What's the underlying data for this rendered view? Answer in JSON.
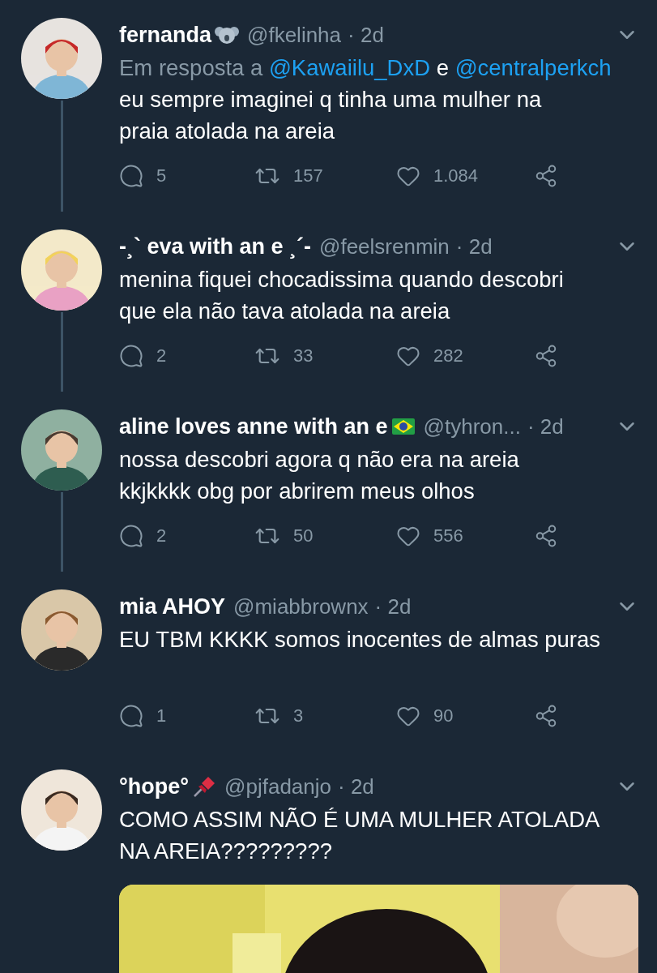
{
  "tweets": [
    {
      "name": "fernanda",
      "badge": {
        "kind": "koala"
      },
      "handle": "@fkelinha",
      "time": "· 2d",
      "reply_to": {
        "prefix": "Em resposta a",
        "users": [
          "@Kawaiilu_DxD",
          "@centralperkch"
        ],
        "joiner": "e"
      },
      "text_lines": [
        "eu sempre imaginei q tinha uma mulher na",
        "praia atolada na areia"
      ],
      "replies": "5",
      "retweets": "157",
      "likes": "1.084",
      "thread_continues": true
    },
    {
      "name": "-¸` eva with an e ¸´-",
      "handle": "@feelsrenmin",
      "time": "· 2d",
      "text_lines": [
        "menina fiquei chocadissima quando descobri",
        "que ela não tava atolada na areia"
      ],
      "replies": "2",
      "retweets": "33",
      "likes": "282",
      "thread_continues": true
    },
    {
      "name": "aline loves anne with an e",
      "badge": {
        "kind": "flag"
      },
      "handle": "@tyhron...",
      "time": "· 2d",
      "text_lines": [
        "nossa descobri agora q não era na areia",
        "kkjkkkk obg por abrirem meus olhos"
      ],
      "replies": "2",
      "retweets": "50",
      "likes": "556",
      "thread_continues": true
    },
    {
      "name": "mia AHOY",
      "handle": "@miabbrownx",
      "time": "· 2d",
      "text_lines": [
        "EU TBM KKKK somos inocentes de almas puras"
      ],
      "replies": "1",
      "retweets": "3",
      "likes": "90",
      "thread_continues": false
    },
    {
      "name": "°hope°",
      "badge": {
        "kind": "pin"
      },
      "handle": "@pjfadanjo",
      "time": "· 2d",
      "text_lines": [
        "COMO ASSIM NÃO É UMA MULHER ATOLADA",
        "NA AREIA?????????"
      ],
      "thread_continues": false
    }
  ]
}
